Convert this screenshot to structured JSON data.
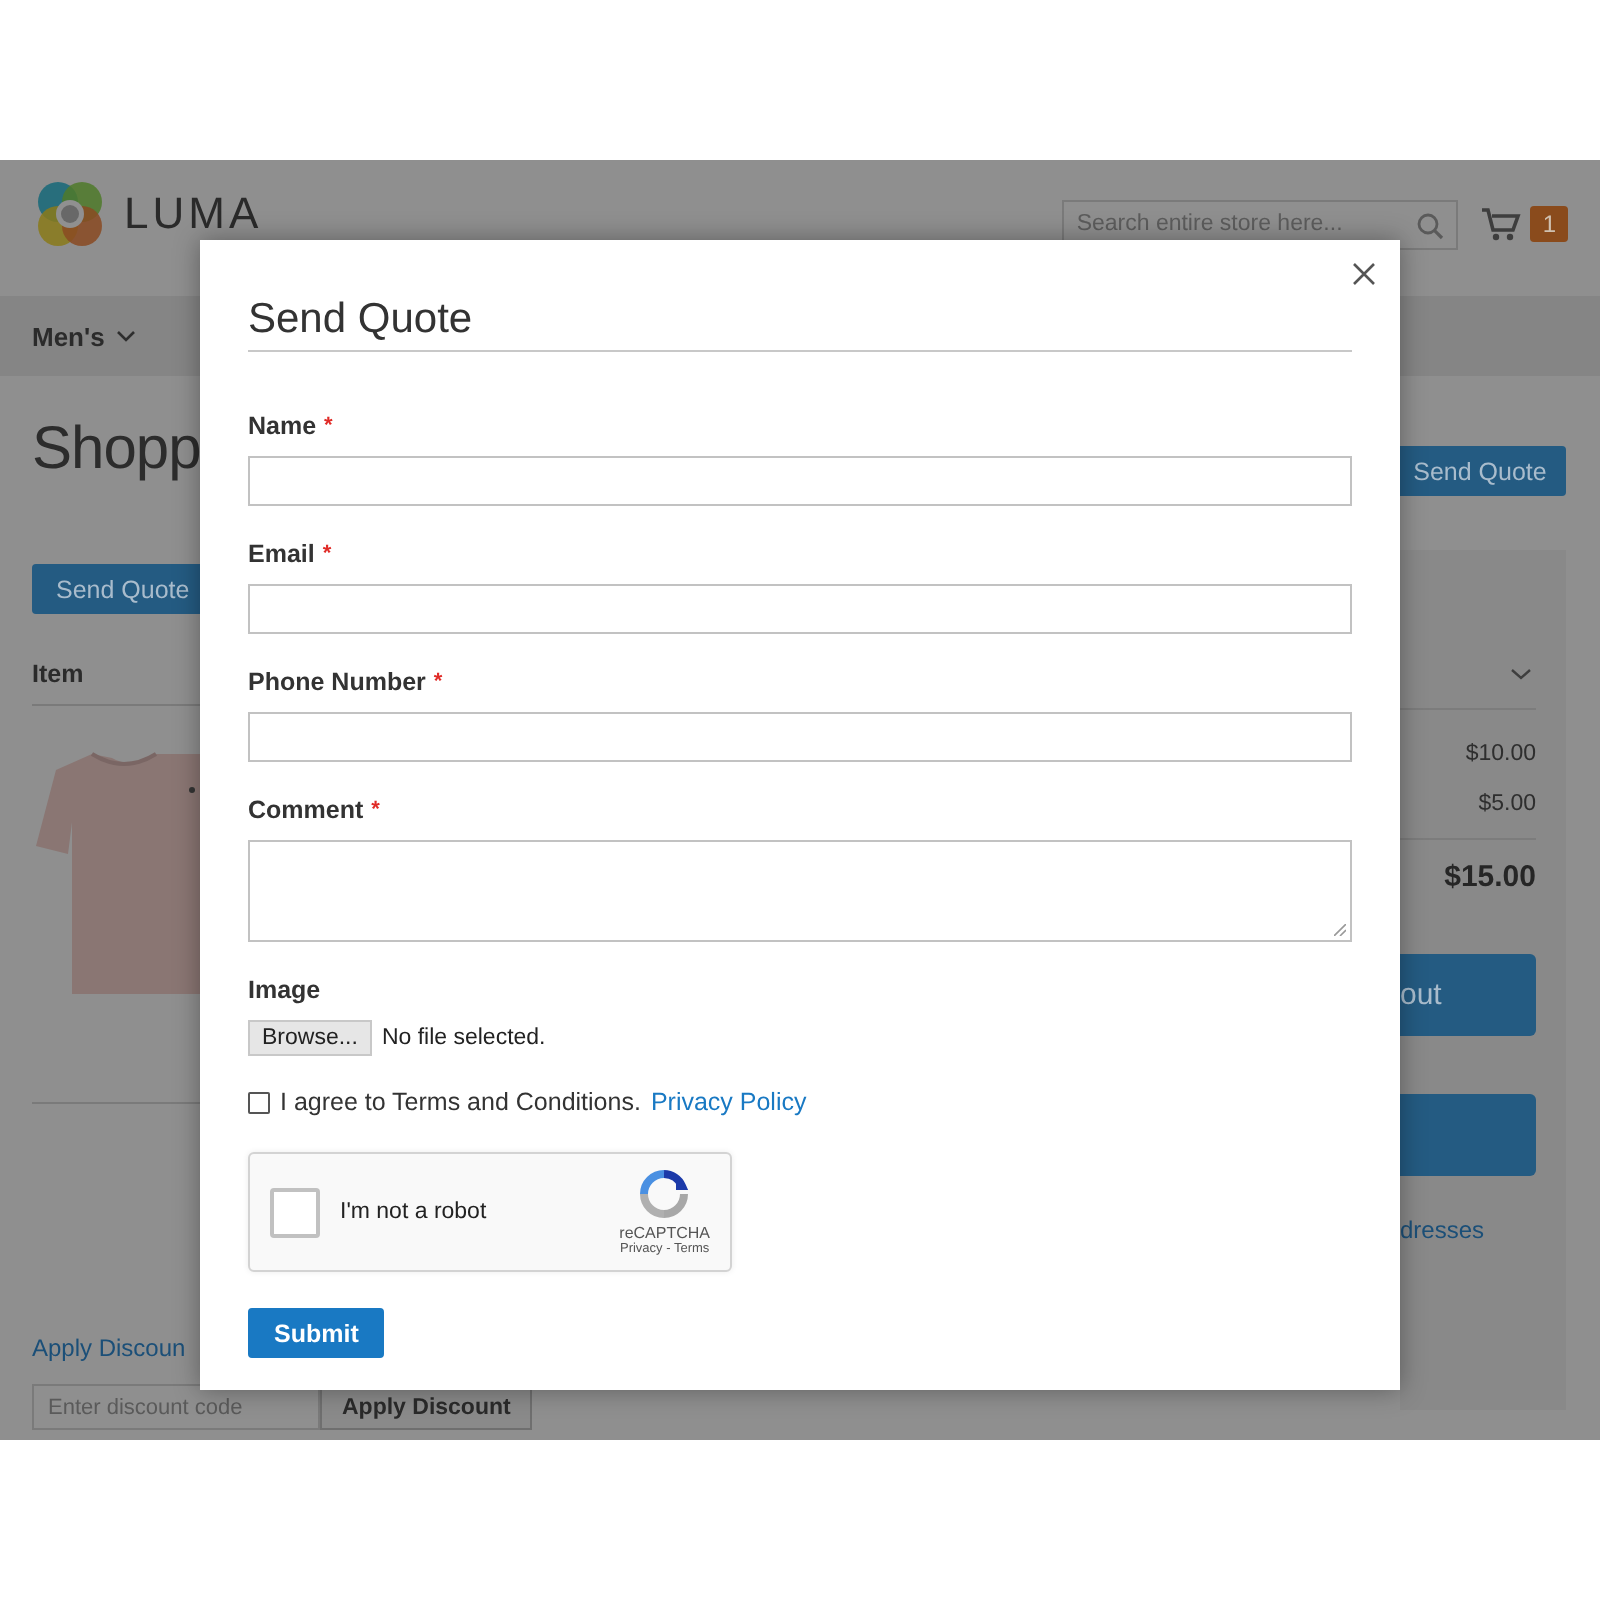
{
  "header": {
    "logo": "LUMA",
    "search": {
      "placeholder": "Search entire store here..."
    },
    "cart_count": "1"
  },
  "nav": [
    {
      "label": "Men's"
    }
  ],
  "page": {
    "title": "Shopp",
    "send_quote": "Send Quote",
    "column_item": "Item",
    "apply_discount": "Apply Discoun",
    "discount_placeholder": "Enter discount code",
    "apply_button": "Apply Discount"
  },
  "summary": {
    "send_quote": "Send Quote",
    "amounts": [
      "$10.00",
      "$5.00"
    ],
    "total": "$15.00",
    "checkout": "out",
    "addresses": "dresses"
  },
  "modal": {
    "title": "Send Quote",
    "required_mark": "*",
    "fields": [
      {
        "label": "Name",
        "required": true,
        "kind": "input"
      },
      {
        "label": "Email",
        "required": true,
        "kind": "input"
      },
      {
        "label": "Phone Number",
        "required": true,
        "kind": "input"
      },
      {
        "label": "Comment",
        "required": true,
        "kind": "textarea"
      }
    ],
    "image": {
      "label": "Image",
      "button": "Browse...",
      "status": "No file selected."
    },
    "agree": {
      "text": "I agree to Terms and Conditions.",
      "link": "Privacy Policy",
      "checked": false
    },
    "captcha": {
      "label": "I'm not a robot",
      "brand": "reCAPTCHA",
      "links": "Privacy - Terms",
      "checked": false
    },
    "submit": "Submit"
  }
}
